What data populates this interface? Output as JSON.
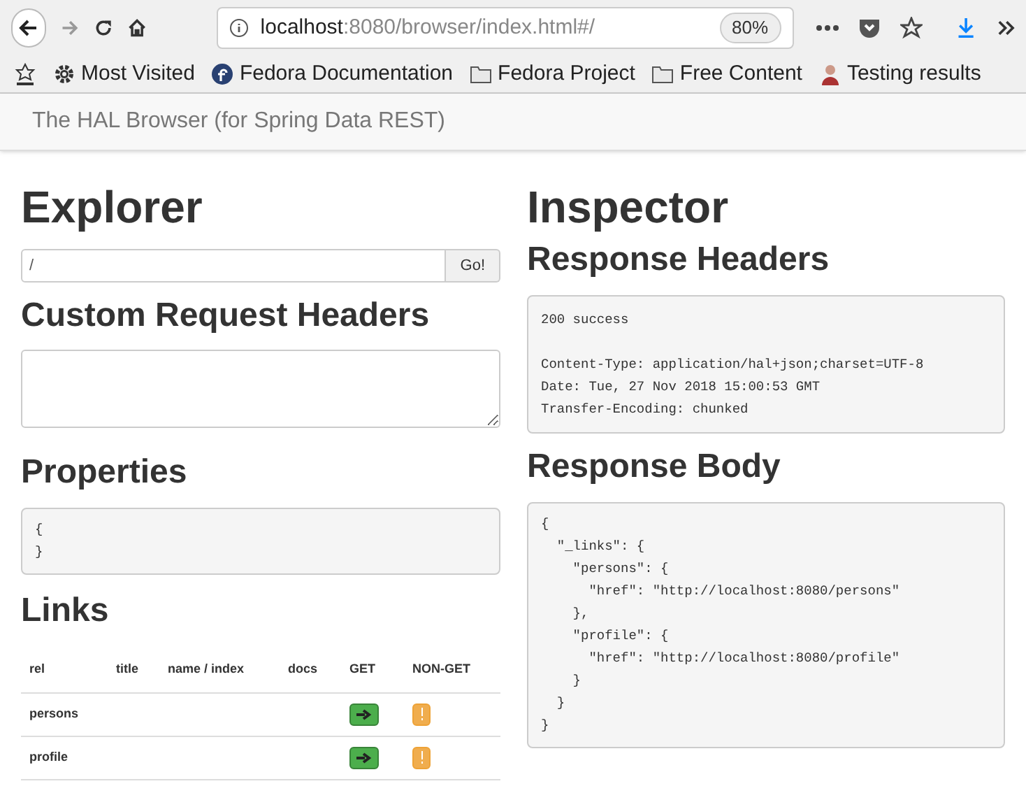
{
  "browser": {
    "url_host": "localhost",
    "url_path": ":8080/browser/index.html#/",
    "zoom": "80%",
    "bookmarks": [
      {
        "kind": "gear",
        "label": "Most Visited"
      },
      {
        "kind": "fedora",
        "label": "Fedora Documentation"
      },
      {
        "kind": "folder",
        "label": "Fedora Project"
      },
      {
        "kind": "folder",
        "label": "Free Content"
      },
      {
        "kind": "person",
        "label": "Testing results"
      }
    ]
  },
  "navbar": {
    "title": "The HAL Browser (for Spring Data REST)"
  },
  "explorer": {
    "title": "Explorer",
    "url_value": "/",
    "go_button": "Go!",
    "custom_headers_title": "Custom Request Headers",
    "properties_title": "Properties",
    "properties_lines": [
      "{",
      "}"
    ],
    "links_title": "Links",
    "links_columns": [
      "rel",
      "title",
      "name / index",
      "docs",
      "GET",
      "NON-GET"
    ],
    "links_rows": [
      {
        "rel": "persons"
      },
      {
        "rel": "profile"
      }
    ]
  },
  "inspector": {
    "title": "Inspector",
    "headers_title": "Response Headers",
    "status": "200 success",
    "headers": [
      "Content-Type: application/hal+json;charset=UTF-8",
      "Date: Tue, 27 Nov 2018 15:00:53 GMT",
      "Transfer-Encoding: chunked"
    ],
    "body_title": "Response Body",
    "body_lines": [
      "{",
      "  \"_links\": {",
      "    \"persons\": {",
      "      \"href\": \"http://localhost:8080/persons\"",
      "    },",
      "    \"profile\": {",
      "      \"href\": \"http://localhost:8080/profile\"",
      "    }",
      "  }",
      "}"
    ]
  }
}
